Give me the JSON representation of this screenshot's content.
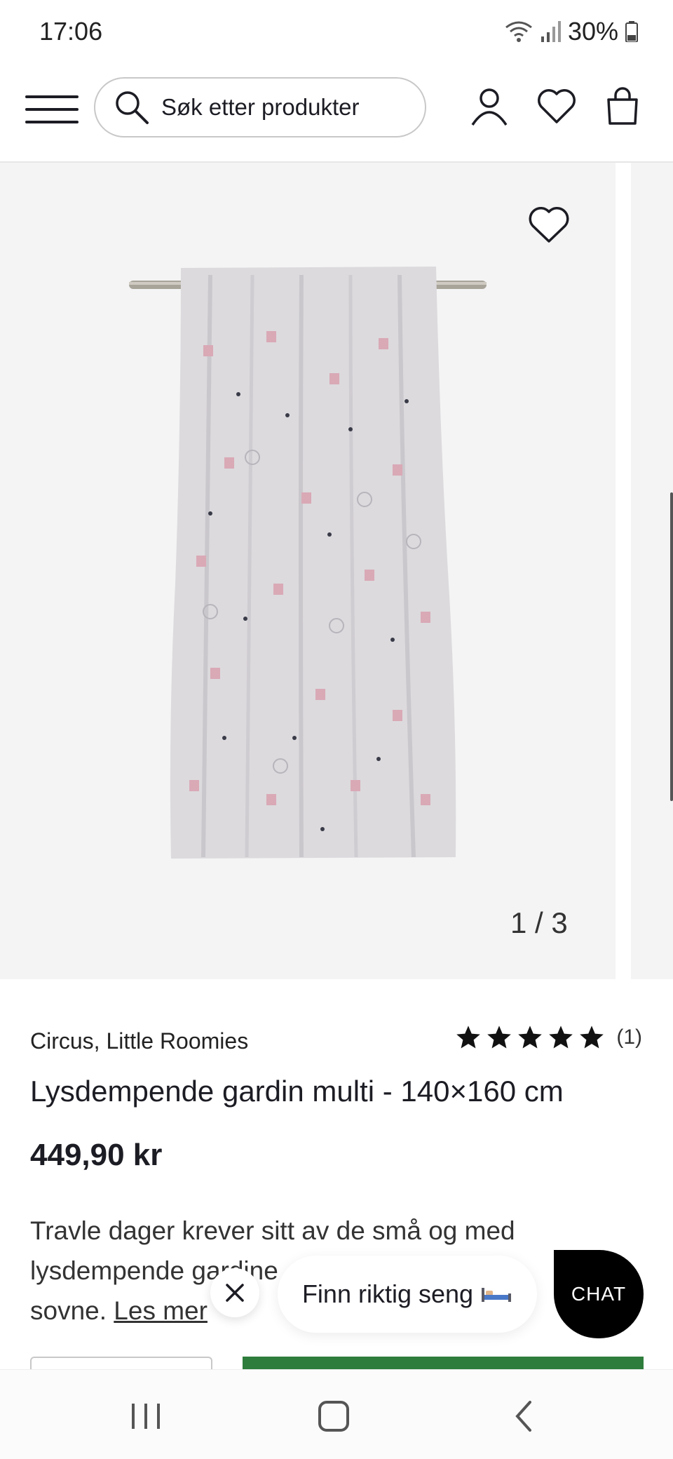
{
  "status_bar": {
    "time": "17:06",
    "battery": "30%"
  },
  "header": {
    "search_placeholder": "Søk etter produkter",
    "icons": [
      "menu-icon",
      "search-icon",
      "account-icon",
      "wishlist-icon",
      "cart-icon"
    ]
  },
  "gallery": {
    "counter": "1 / 3",
    "current_image": 1,
    "total_images": 3
  },
  "product": {
    "brand": "Circus, Little Roomies",
    "rating_stars": 5,
    "rating_count": "(1)",
    "title": "Lysdempende gardin multi - 140×160 cm",
    "price": "449,90 kr",
    "description_line1": "Travle dager krever sitt av de små og med",
    "description_line2": "lysdempende gardine",
    "description_line3": "sovne.",
    "read_more": "Les mer"
  },
  "chat": {
    "bed_prompt": "Finn riktig seng",
    "chat_label": "CHAT"
  },
  "colors": {
    "accent_green": "#2e7d3c",
    "text_dark": "#1c1c24",
    "chat_bg": "#000000"
  }
}
